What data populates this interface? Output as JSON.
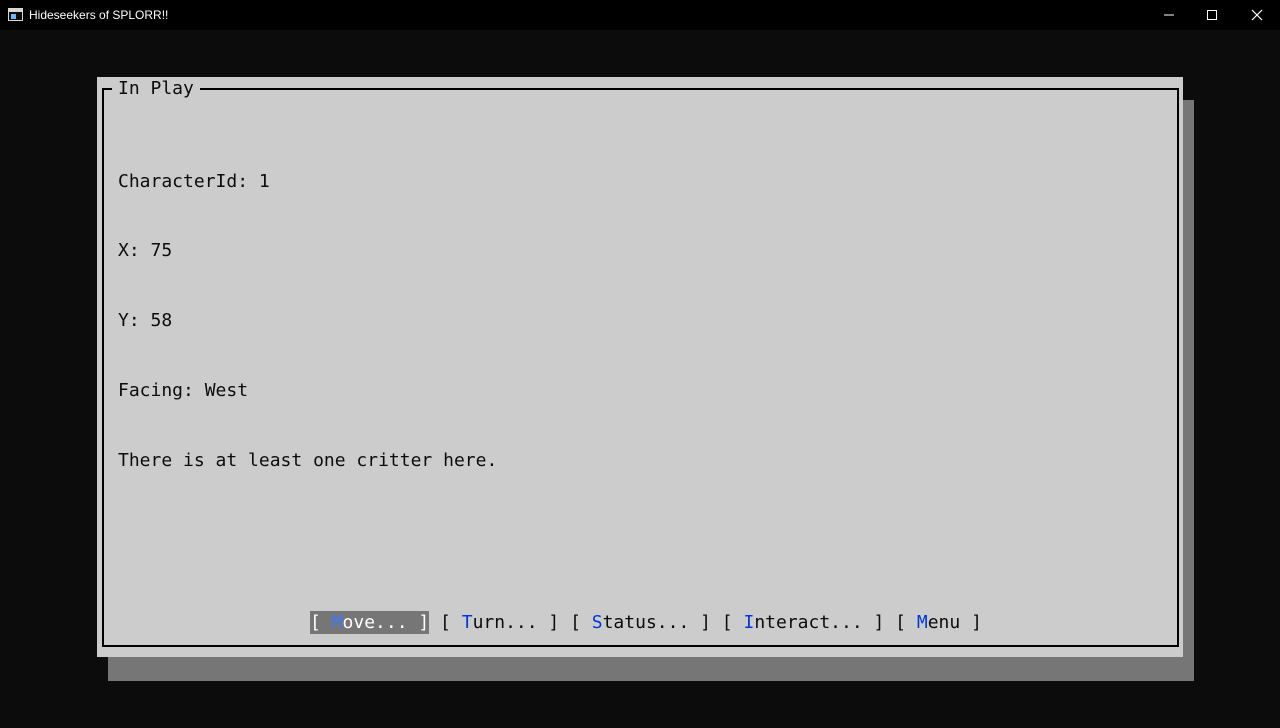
{
  "window": {
    "title": "Hideseekers of SPLORR!!",
    "icon": "console-window-icon",
    "controls": [
      "minimize-icon",
      "maximize-icon",
      "close-icon"
    ]
  },
  "panel": {
    "title": "In Play"
  },
  "status": {
    "character_id": "CharacterId: 1",
    "x": "X: 75",
    "y": "Y: 58",
    "facing": "Facing: West",
    "message": "There is at least one critter here."
  },
  "buttons": [
    {
      "open": "[ ",
      "hotkey": "M",
      "rest": "ove... ",
      "close": "]",
      "focused": true
    },
    {
      "open": "[ ",
      "hotkey": "T",
      "rest": "urn... ",
      "close": "]",
      "focused": false
    },
    {
      "open": "[ ",
      "hotkey": "S",
      "rest": "tatus... ",
      "close": "]",
      "focused": false
    },
    {
      "open": "[ ",
      "hotkey": "I",
      "rest": "nteract... ",
      "close": "]",
      "focused": false
    },
    {
      "open": "[ ",
      "hotkey": "M",
      "rest": "enu ",
      "close": "]",
      "focused": false
    }
  ],
  "colors": {
    "console_bg": "#0c0c0c",
    "panel_bg": "#cccccc",
    "shadow": "#767676",
    "hotkey": "#0037da",
    "focus_bg": "#767676"
  }
}
